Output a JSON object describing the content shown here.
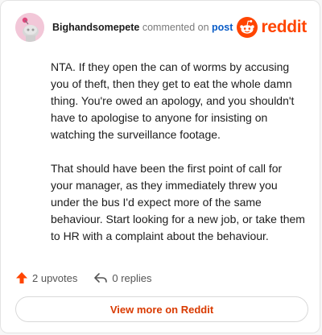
{
  "header": {
    "author": "Bighandsomepete",
    "action_text": "commented on",
    "post_link": "post",
    "logo_text": "reddit",
    "brand_color": "#ff4500"
  },
  "comment": {
    "paragraphs": [
      "NTA. If they open the can of worms by accusing you of theft, then they get to eat the whole damn thing. You're owed an apology, and you shouldn't have to apologise to anyone for insisting on watching the surveillance footage.",
      "That should have been the first point of call for your manager, as they immediately threw you under the bus I'd expect more of the same behaviour. Start looking for a new job, or take them to HR with a complaint about the behaviour."
    ]
  },
  "footer": {
    "upvotes": "2 upvotes",
    "replies": "0 replies",
    "icons": [
      "upvote-arrow-icon",
      "reply-arrow-icon"
    ]
  },
  "cta": {
    "label": "View more on Reddit"
  }
}
